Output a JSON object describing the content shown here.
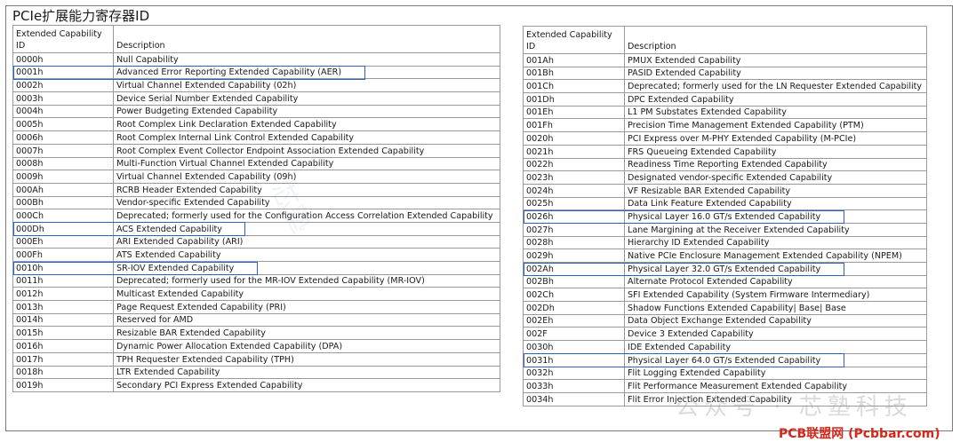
{
  "title": "PCIe扩展能力寄存器ID",
  "headers": {
    "id": "Extended Capability ID",
    "description": "Description"
  },
  "left_rows": [
    {
      "id": "0000h",
      "desc": "Null Capability"
    },
    {
      "id": "0001h",
      "desc": "Advanced Error Reporting Extended Capability (AER)"
    },
    {
      "id": "0002h",
      "desc": "Virtual Channel Extended Capability (02h)"
    },
    {
      "id": "0003h",
      "desc": "Device Serial Number Extended Capability"
    },
    {
      "id": "0004h",
      "desc": "Power Budgeting Extended Capability"
    },
    {
      "id": "0005h",
      "desc": " Root Complex Link Declaration Extended Capability"
    },
    {
      "id": "0006h",
      "desc": "Root Complex Internal Link Control Extended Capability"
    },
    {
      "id": "0007h",
      "desc": "Root Complex Event Collector Endpoint Association Extended Capability"
    },
    {
      "id": "0008h",
      "desc": "Multi-Function Virtual Channel Extended Capability"
    },
    {
      "id": "0009h",
      "desc": "Virtual Channel Extended Capability (09h)"
    },
    {
      "id": "000Ah",
      "desc": "RCRB Header Extended Capability"
    },
    {
      "id": "000Bh",
      "desc": "Vendor-specific Extended Capability"
    },
    {
      "id": "000Ch",
      "desc": "Deprecated; formerly used for the Configuration Access Correlation Extended Capability"
    },
    {
      "id": "000Dh",
      "desc": "ACS Extended Capability"
    },
    {
      "id": "000Eh",
      "desc": "ARI Extended Capability (ARI)"
    },
    {
      "id": "000Fh",
      "desc": "ATS Extended Capability"
    },
    {
      "id": "0010h",
      "desc": "SR-IOV Extended Capability"
    },
    {
      "id": "0011h",
      "desc": "Deprecated; formerly used for the MR-IOV Extended Capability (MR-IOV)"
    },
    {
      "id": "0012h",
      "desc": "Multicast Extended Capability"
    },
    {
      "id": "0013h",
      "desc": "Page Request Extended Capability (PRI)"
    },
    {
      "id": "0014h",
      "desc": "Reserved for AMD"
    },
    {
      "id": "0015h",
      "desc": "Resizable BAR Extended Capability"
    },
    {
      "id": "0016h",
      "desc": "Dynamic Power Allocation Extended Capability (DPA)"
    },
    {
      "id": "0017h",
      "desc": "TPH Requester Extended Capability (TPH)"
    },
    {
      "id": "0018h",
      "desc": "LTR Extended Capability"
    },
    {
      "id": "0019h",
      "desc": "Secondary PCI Express Extended Capability"
    }
  ],
  "right_rows": [
    {
      "id": "001Ah",
      "desc": "PMUX Extended Capability"
    },
    {
      "id": "001Bh",
      "desc": "PASID Extended Capability"
    },
    {
      "id": "001Ch",
      "desc": "Deprecated; formerly used for the LN Requester Extended Capability"
    },
    {
      "id": "001Dh",
      "desc": "DPC Extended Capability"
    },
    {
      "id": "001Eh",
      "desc": "L1 PM Substates Extended Capability"
    },
    {
      "id": "001Fh",
      "desc": "Precision Time Management Extended Capability (PTM)"
    },
    {
      "id": "0020h",
      "desc": "PCI Express over M-PHY Extended Capability (M-PCIe)"
    },
    {
      "id": "0021h",
      "desc": "FRS Queueing Extended Capability"
    },
    {
      "id": "0022h",
      "desc": "Readiness Time Reporting Extended Capability"
    },
    {
      "id": "0023h",
      "desc": "Designated vendor-specific Extended Capability"
    },
    {
      "id": "0024h",
      "desc": "VF Resizable BAR Extended Capability"
    },
    {
      "id": "0025h",
      "desc": "Data Link Feature Extended Capability"
    },
    {
      "id": "0026h",
      "desc": "Physical Layer 16.0 GT/s Extended Capability"
    },
    {
      "id": "0027h",
      "desc": " Lane Margining at the Receiver Extended Capability"
    },
    {
      "id": "0028h",
      "desc": "Hierarchy ID Extended Capability"
    },
    {
      "id": "0029h",
      "desc": "Native PCIe Enclosure Management Extended Capability (NPEM)"
    },
    {
      "id": "002Ah",
      "desc": "Physical Layer 32.0 GT/s Extended Capability"
    },
    {
      "id": "002Bh",
      "desc": "Alternate Protocol Extended Capability"
    },
    {
      "id": "002Ch",
      "desc": "SFI Extended Capability (System Firmware Intermediary)"
    },
    {
      "id": "002Dh",
      "desc": "Shadow Functions Extended Capability| Base| Base"
    },
    {
      "id": "002Eh",
      "desc": "Data Object Exchange Extended Capability"
    },
    {
      "id": "002F",
      "desc": "Device 3 Extended Capability"
    },
    {
      "id": "0030h",
      "desc": "IDE Extended Capability"
    },
    {
      "id": "0031h",
      "desc": "Physical Layer 64.0 GT/s Extended Capability"
    },
    {
      "id": "0032h",
      "desc": "Flit Logging Extended Capability"
    },
    {
      "id": "0033h",
      "desc": "Flit Performance Measurement Extended Capability"
    },
    {
      "id": "0034h",
      "desc": " Flit Error Injection Extended Capability"
    }
  ],
  "highlighted_ids": [
    "0001h",
    "000Dh",
    "0010h",
    "0026h",
    "002Ah",
    "0031h"
  ],
  "highlight_color": "#2f5fbf",
  "watermarks": {
    "faint": "公众号 · 芯塾科技",
    "bottom": "PCB联盟网 (Pcbbar.com)"
  },
  "watermark_color": "#d4281b"
}
